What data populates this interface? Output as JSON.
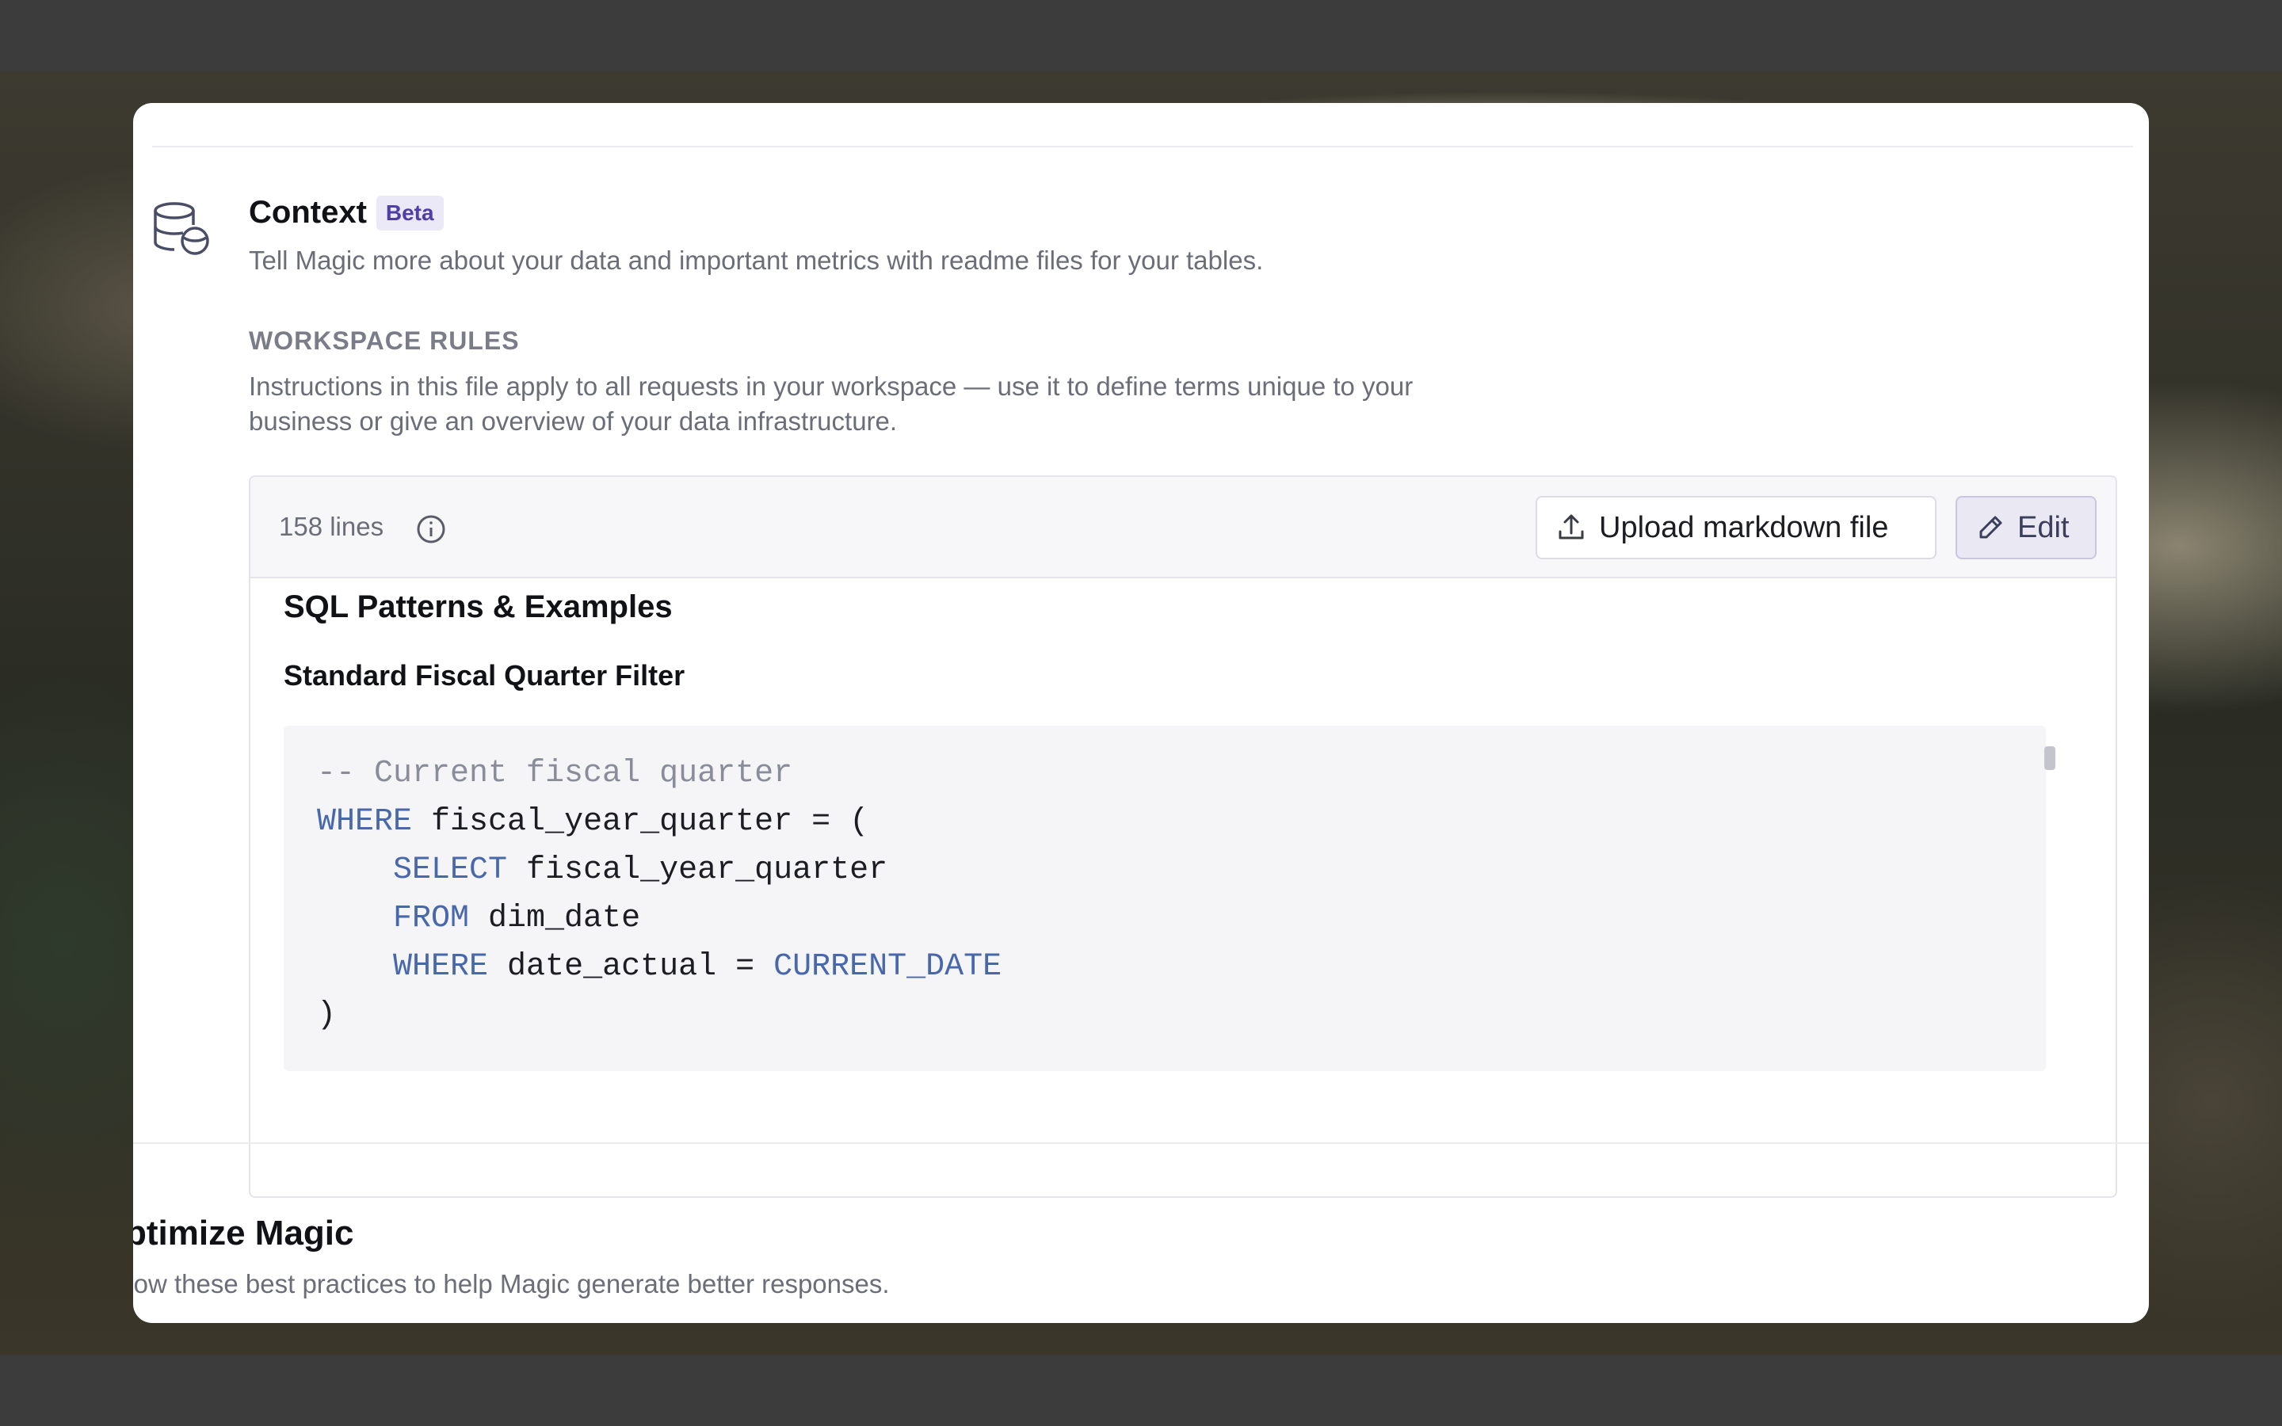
{
  "context": {
    "icon": "database-stack-icon",
    "title": "Context",
    "badge": "Beta",
    "description": "Tell Magic more about your data and important metrics with readme files for your tables."
  },
  "workspace_rules": {
    "heading": "WORKSPACE RULES",
    "description_line1": "Instructions in this file apply to all requests in your workspace — use it to define terms unique to your",
    "description_line2": "business or give an overview of your data infrastructure."
  },
  "editor": {
    "lines_count": "158 lines",
    "info_icon": "info-icon",
    "upload_button": {
      "label": "Upload markdown file",
      "icon": "upload-icon"
    },
    "edit_button": {
      "label": "Edit",
      "icon": "pencil-icon"
    },
    "heading_h2": "SQL Patterns & Examples",
    "heading_h3": "Standard Fiscal Quarter Filter",
    "code": {
      "line1_comment": "-- Current fiscal quarter",
      "line2_kw": "WHERE",
      "line2_rest": " fiscal_year_quarter = (",
      "line3_indent": "    ",
      "line3_kw": "SELECT",
      "line3_rest": " fiscal_year_quarter",
      "line4_indent": "    ",
      "line4_kw": "FROM",
      "line4_rest": " dim_date",
      "line5_indent": "    ",
      "line5_kw": "WHERE",
      "line5_mid": " date_actual = ",
      "line5_kw2": "CURRENT_DATE",
      "line6": ")"
    }
  },
  "optimize": {
    "title": "ptimize Magic",
    "description": "llow these best practices to help Magic generate better responses."
  },
  "colors": {
    "accent": "#4f3ea6",
    "keyword": "#4868ac",
    "comment": "#8a8d99"
  }
}
